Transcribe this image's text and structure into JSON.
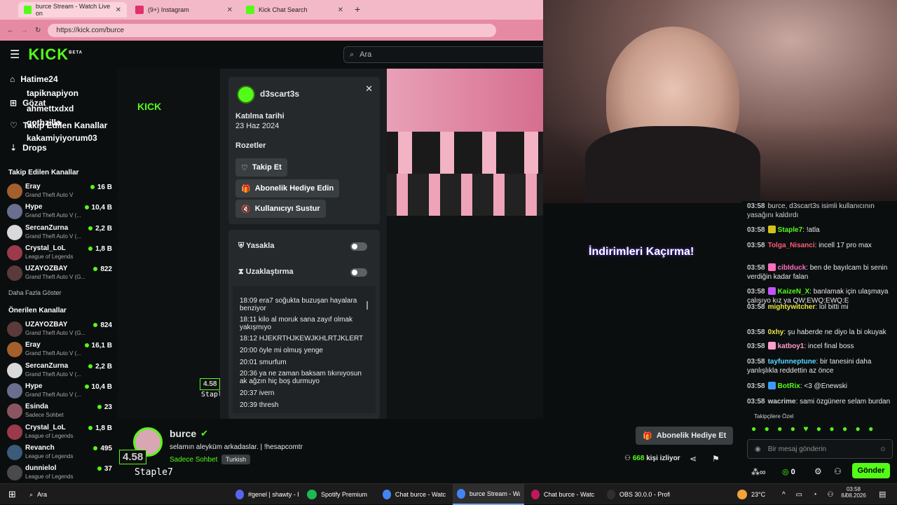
{
  "browser": {
    "tabs": [
      {
        "title": "burce Stream - Watch Live on",
        "favicon_color": "#53fc18"
      },
      {
        "title": "(9+) Instagram",
        "favicon_color": "#e1306c"
      },
      {
        "title": "Kick Chat Search",
        "favicon_color": "#53fc18"
      }
    ],
    "url": "https://kick.com/burce"
  },
  "kick": {
    "logo": "KICK",
    "logo_sup": "BETA",
    "search_placeholder": "Ara",
    "accent": "#53fc18"
  },
  "sidebar": {
    "nav": [
      {
        "label": "Hatime24",
        "icon": "home-icon"
      },
      {
        "label": "tapiknapiyon",
        "icon": "compass-icon"
      },
      {
        "label": "Gözat",
        "icon": "compass-icon"
      },
      {
        "label": "ahmettxdxd",
        "icon": "heart-icon"
      },
      {
        "label": "gothzilla",
        "icon": "heart-icon"
      },
      {
        "label": "Takip Edilen Kanallar",
        "icon": "heart-icon"
      },
      {
        "label": "kakamiyiyorum03",
        "icon": "drops-icon"
      },
      {
        "label": "Drops",
        "icon": "drops-icon"
      }
    ],
    "followed_title": "Takip Edilen Kanallar",
    "followed": [
      {
        "name": "Eray",
        "game": "Grand Theft Auto V",
        "viewers": "16 B",
        "color": "#a35f2c"
      },
      {
        "name": "Hype",
        "game": "Grand Theft Auto V (...",
        "viewers": "10,4 B",
        "color": "#6a6f8f"
      },
      {
        "name": "SercanZurna",
        "game": "Grand Theft Auto V (...",
        "viewers": "2,2 B",
        "color": "#d9d9d9"
      },
      {
        "name": "Crystal_LoL",
        "game": "League of Legends",
        "viewers": "1,8 B",
        "color": "#9b3a4a"
      },
      {
        "name": "UZAYOZBAY",
        "game": "Grand Theft Auto V (G...",
        "viewers": "822",
        "color": "#5a3a3a"
      }
    ],
    "show_more": "Daha Fazla Göster",
    "recommended_title": "Önerilen Kanallar",
    "recommended": [
      {
        "name": "UZAYOZBAY",
        "game": "Grand Theft Auto V (G...",
        "viewers": "824",
        "color": "#5a3a3a"
      },
      {
        "name": "Eray",
        "game": "Grand Theft Auto V (...",
        "viewers": "16,1 B",
        "color": "#a35f2c"
      },
      {
        "name": "SercanZurna",
        "game": "Grand Theft Auto V (...",
        "viewers": "2,2 B",
        "color": "#d9d9d9"
      },
      {
        "name": "Hype",
        "game": "Grand Theft Auto V (...",
        "viewers": "10,4 B",
        "color": "#6a6f8f"
      },
      {
        "name": "Esinda",
        "game": "Sadece Sohbet",
        "viewers": "23",
        "color": "#8a5560"
      },
      {
        "name": "Crystal_LoL",
        "game": "League of Legends",
        "viewers": "1,8 B",
        "color": "#9b3a4a"
      },
      {
        "name": "Revanch",
        "game": "League of Legends",
        "viewers": "495",
        "color": "#3c5a7a"
      },
      {
        "name": "dunnielol",
        "game": "League of Legends",
        "viewers": "37",
        "color": "#4a4a4a"
      }
    ]
  },
  "popup": {
    "username": "d3scart3s",
    "join_label": "Katılma tarihi",
    "join_date": "23 Haz 2024",
    "badges_label": "Rozetler",
    "follow_btn": "Takip Et",
    "gift_btn": "Abonelik Hediye Edin",
    "mute_btn": "Kullanıcıyı Sustur",
    "ban_label": "Yasakla",
    "timeout_label": "Uzaklaştırma",
    "messages": [
      "18:09 era7 soğukta buzuşan hayalara benziyor",
      "18:11 kilo al moruk sana zayıf olmak yakışmıyo",
      "18:12 HJEKRTHJKEWJKHLRTJKLERT",
      "20:00 öyle mi olmuş yenge",
      "20:01 smurfum",
      "20:36 ya ne zaman baksam tıkınıyosun ak ağzın hiç boş durmuyo",
      "20:37 ivern",
      "20:39 thresh"
    ]
  },
  "overlay": {
    "text": "İndirimleri Kaçırma!",
    "score": "4.58",
    "caption": "Staple7"
  },
  "chat": {
    "messages": [
      {
        "time": "03:58",
        "user": "burce",
        "text": "burce, d3scart3s isimli kullanıcının yasağını kaldırdı",
        "color": "#cfcfcf",
        "badge": ""
      },
      {
        "time": "03:58",
        "user": "Staple7",
        "text": ": !atla",
        "color": "#53fc18",
        "badge": "#d2c11a"
      },
      {
        "time": "03:58",
        "user": "Tolga_Nisanci",
        "text": ": incell 17 pro max",
        "color": "#ff5a79",
        "badge": ""
      },
      {
        "time": "03:58",
        "user": "cibIduck",
        "text": ": ben de bayılcam bi senin verdiğin kadar falan",
        "color": "#ff6fc0",
        "badge": "#ff6fc0"
      },
      {
        "time": "03:58",
        "user": "KaizeN_X",
        "text": ": banlamak için ulaşmaya çalışıyo kız ya QW:EWQ:EWQ:E",
        "color": "#53fc18",
        "badge": "#c055ff"
      },
      {
        "time": "03:58",
        "user": "mightywitcher",
        "text": ": lol bitti mi",
        "color": "#e8e843",
        "badge": ""
      },
      {
        "time": "03:58",
        "user": "0xhy",
        "text": ": şu haberde ne diyo la bi okuyak",
        "color": "#e8e843",
        "badge": ""
      },
      {
        "time": "03:58",
        "user": "katboy1",
        "text": ": incel final boss",
        "color": "#ff9ecb",
        "badge": "#ff9ecb"
      },
      {
        "time": "03:58",
        "user": "tayfunneptune",
        "text": ": bir tanesini daha yanlışlıkla reddettin az önce",
        "color": "#5ad7ff",
        "badge": ""
      },
      {
        "time": "03:58",
        "user": "BotRix",
        "text": ": <3 @Enewski",
        "color": "#53fc18",
        "badge": "#3b9bff"
      },
      {
        "time": "03:58",
        "user": "wacrime",
        "text": ": sami özgünere selam burdan",
        "color": "#cfcfcf",
        "badge": ""
      }
    ],
    "emote_label": "Takipçilere Özel",
    "input_placeholder": "Bir mesaj gönderin",
    "infinity": "∞",
    "points": "0",
    "send_label": "Gönder"
  },
  "stream": {
    "name": "burce",
    "title": "selamın aleyküm arkadaslar. | !hesapcomtr",
    "category": "Sadece Sohbet",
    "tag": "Turkish",
    "gift_btn": "Abonelik Hediye Et",
    "viewers": "668",
    "viewers_label": "kişi izliyor"
  },
  "taskbar": {
    "search": "Ara",
    "items": [
      {
        "label": "#genel | shawty - D...",
        "color": "#5865f2"
      },
      {
        "label": "Spotify Premium",
        "color": "#1db954"
      },
      {
        "label": "Chat burce - Watch...",
        "color": "#4285f4"
      },
      {
        "label": "burce Stream - Wat...",
        "color": "#4285f4"
      },
      {
        "label": "Chat burce - Watch...",
        "color": "#c2185b"
      },
      {
        "label": "OBS 30.0.0 - Profil:...",
        "color": "#302e31"
      }
    ],
    "weather": "23°C",
    "time": "03:58",
    "date": "8.08.2026"
  }
}
